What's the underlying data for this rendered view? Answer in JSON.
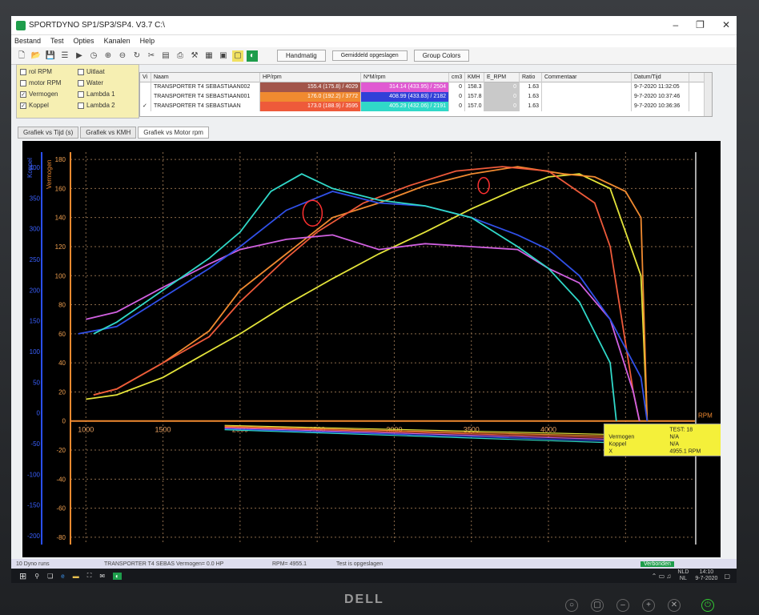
{
  "window": {
    "title": "SPORTDYNO SP1/SP3/SP4. V3.7  C:\\"
  },
  "menu": [
    "Bestand",
    "Test",
    "Opties",
    "Kanalen",
    "Help"
  ],
  "toolbar": {
    "btn_manual": "Handmatig",
    "btn_saved": "Gemiddeld opgeslagen",
    "btn_colors": "Group Colors"
  },
  "channels": [
    {
      "label": "rol RPM",
      "checked": false
    },
    {
      "label": "Uitlaat",
      "checked": false
    },
    {
      "label": "motor RPM",
      "checked": false
    },
    {
      "label": "Water",
      "checked": false
    },
    {
      "label": "Vermogen",
      "checked": true
    },
    {
      "label": "Lambda 1",
      "checked": false
    },
    {
      "label": "Koppel",
      "checked": true
    },
    {
      "label": "Lambda 2",
      "checked": false
    }
  ],
  "table": {
    "headers": [
      "Vi",
      "Naam",
      "HP/rpm",
      "N*M/rpm",
      "cm3",
      "KMH",
      "E_RPM",
      "Ratio",
      "Commentaar",
      "Datum/Tijd"
    ],
    "rows": [
      {
        "name": "TRANSPORTER T4 SEBASTIAAN002",
        "hp": "155.4 (175.8) / 4029",
        "nm": "314.14 (433.95) / 2504",
        "cm3": "0",
        "kmh": "158.3",
        "erpm": "0",
        "ratio": "1.63",
        "date": "9-7-2020 11:32:05",
        "hpColor": "#a2554a",
        "nmColor": "#e05ad2"
      },
      {
        "name": "TRANSPORTER T4 SEBASTIAAN001",
        "hp": "176.0 (192.2) / 3772",
        "nm": "408.99 (433.83) / 2182",
        "cm3": "0",
        "kmh": "157.8",
        "erpm": "0",
        "ratio": "1.63",
        "date": "9-7-2020 10:37:46",
        "hpColor": "#f08a30",
        "nmColor": "#3040d8"
      },
      {
        "name": "TRANSPORTER T4 SEBASTIAAN",
        "hp": "173.0 (188.9) / 3595",
        "nm": "405.29 (432.06) / 2191",
        "cm3": "0",
        "kmh": "157.0",
        "erpm": "0",
        "ratio": "1.63",
        "date": "9-7-2020 10:36:36",
        "hpColor": "#ee5a3a",
        "nmColor": "#30d8c8"
      }
    ]
  },
  "tabs": [
    "Grafiek vs Tijd (s)",
    "Grafiek vs KMH",
    "Grafiek vs Motor rpm"
  ],
  "chart_data": {
    "type": "line",
    "xlabel": "RPM",
    "xlim": [
      900,
      4950
    ],
    "x_ticks": [
      1000,
      1500,
      2000,
      2500,
      3000,
      3500,
      4000,
      4500
    ],
    "y_vermogen_label": "Vermogen",
    "y_koppel_label": "Koppel",
    "y_vermogen_ticks": [
      180,
      160,
      140,
      120,
      100,
      80,
      60,
      40,
      20,
      0,
      -20,
      -40,
      -60,
      -80
    ],
    "y_koppel_ticks": [
      400,
      350,
      300,
      250,
      200,
      150,
      100,
      50,
      0,
      -50,
      -100,
      -150,
      -200
    ],
    "ylim_vermogen": [
      -85,
      185
    ],
    "series": [
      {
        "name": "TRANSPORTER T4 SEBASTIAAN002",
        "color": "#e4e43a",
        "x": [
          1000,
          1200,
          1500,
          1800,
          2000,
          2300,
          2600,
          2900,
          3200,
          3500,
          3800,
          4000,
          4200,
          4400,
          4600
        ],
        "y": [
          15,
          18,
          30,
          48,
          60,
          80,
          98,
          115,
          130,
          146,
          160,
          168,
          170,
          160,
          100
        ]
      },
      {
        "name": "TRANSPORTER T4 SEBASTIAAN001",
        "color": "#f08a30",
        "x": [
          1050,
          1200,
          1500,
          1800,
          2000,
          2300,
          2600,
          2900,
          3200,
          3500,
          3800,
          4100,
          4300,
          4500,
          4600
        ],
        "y": [
          18,
          22,
          40,
          62,
          90,
          115,
          140,
          150,
          162,
          170,
          175,
          170,
          168,
          158,
          140
        ]
      },
      {
        "name": "TRANSPORTER T4 SEBASTIAAN",
        "color": "#ee5a3a",
        "x": [
          1050,
          1200,
          1500,
          1800,
          2000,
          2300,
          2500,
          2800,
          3100,
          3400,
          3700,
          4000,
          4300,
          4400,
          4550
        ],
        "y": [
          18,
          22,
          40,
          58,
          82,
          112,
          130,
          150,
          162,
          172,
          175,
          172,
          150,
          120,
          20
        ]
      },
      {
        "name": "Koppel 002",
        "color": "#d060e0",
        "x": [
          1000,
          1200,
          1500,
          1800,
          2000,
          2300,
          2600,
          2900,
          3200,
          3500,
          3800,
          4000,
          4200,
          4400,
          4550
        ],
        "y": [
          70,
          75,
          92,
          108,
          118,
          125,
          128,
          118,
          122,
          120,
          118,
          105,
          95,
          70,
          20
        ]
      },
      {
        "name": "Koppel 001",
        "color": "#3050e8",
        "x": [
          950,
          1200,
          1500,
          1800,
          2000,
          2300,
          2600,
          2900,
          3200,
          3500,
          3800,
          4000,
          4200,
          4400,
          4600
        ],
        "y": [
          60,
          65,
          85,
          105,
          120,
          145,
          158,
          150,
          148,
          140,
          128,
          118,
          100,
          70,
          30
        ]
      },
      {
        "name": "Koppel",
        "color": "#30d8c8",
        "x": [
          1050,
          1200,
          1500,
          1800,
          2000,
          2200,
          2400,
          2600,
          2900,
          3200,
          3500,
          3800,
          4000,
          4200,
          4400
        ],
        "y": [
          60,
          68,
          90,
          112,
          130,
          158,
          170,
          160,
          152,
          148,
          140,
          120,
          105,
          82,
          40
        ]
      }
    ]
  },
  "tooltip": {
    "title": "TEST: 18",
    "rows": [
      [
        "Vermogen",
        "N/A"
      ],
      [
        "Koppel",
        "N/A"
      ],
      [
        "X",
        "4955.1 RPM"
      ]
    ]
  },
  "status": {
    "left": "10 Dyno runs",
    "mid1": "TRANSPORTER T4 SEBAS  Vermogen= 0.0 HP",
    "mid2": "RPM= 4955.1",
    "mid3": "Test is opgeslagen",
    "right": "Verbonden"
  },
  "taskbar": {
    "lang": "NLD",
    "region": "NL",
    "time": "14:10",
    "date": "9-7-2020"
  },
  "brand": "DELL"
}
